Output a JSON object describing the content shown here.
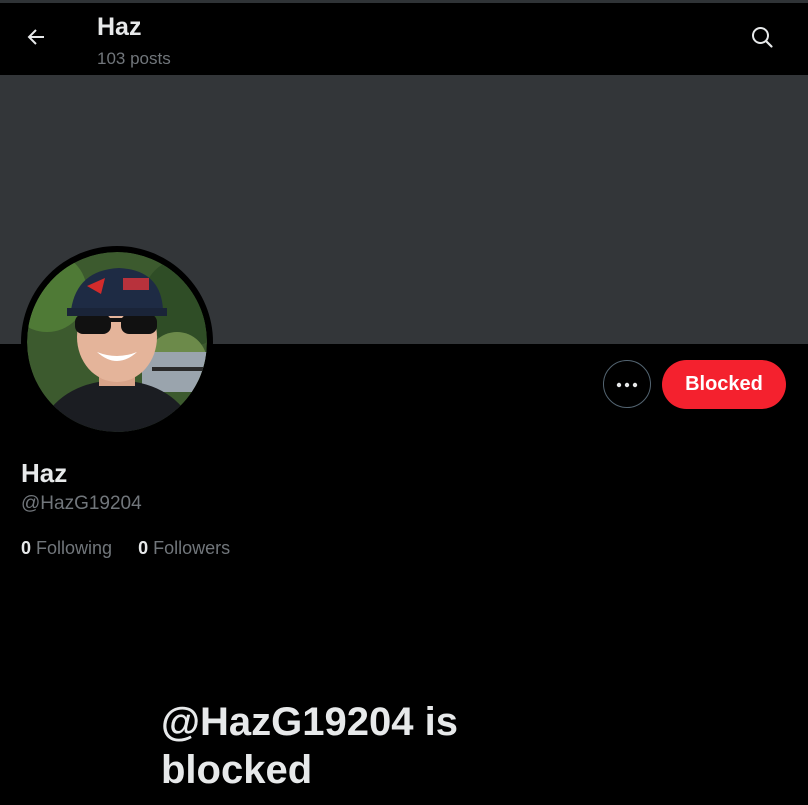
{
  "header": {
    "title": "Haz",
    "post_count": "103 posts"
  },
  "profile": {
    "display_name": "Haz",
    "handle": "@HazG19204",
    "following_count": "0",
    "following_label": "Following",
    "followers_count": "0",
    "followers_label": "Followers"
  },
  "actions": {
    "blocked_label": "Blocked",
    "more_icon": "ellipsis-icon"
  },
  "blocked_message": "@HazG19204 is blocked",
  "icons": {
    "back": "arrow-left-icon",
    "search": "search-icon"
  },
  "colors": {
    "background": "#000000",
    "banner": "#333639",
    "blocked_button": "#f4212e",
    "text_primary": "#e7e9ea",
    "text_secondary": "#71767b"
  }
}
